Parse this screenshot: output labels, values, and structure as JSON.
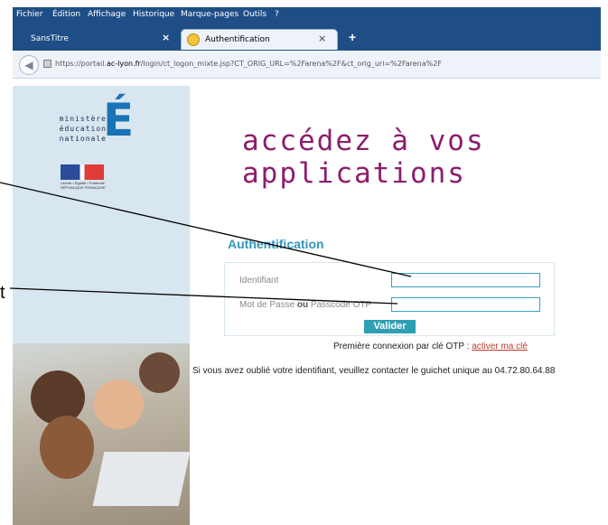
{
  "menu": [
    "Fichier",
    "Édition",
    "Affichage",
    "Historique",
    "Marque-pages",
    "Outils",
    "?"
  ],
  "tabs": {
    "inactive_title": "SansTitre",
    "active_title": "Authentification",
    "close_glyph": "×",
    "new_tab_glyph": "+"
  },
  "address": {
    "prefix": "https://portail.",
    "domain": "ac-lyon.fr",
    "path": "/login/ct_logon_mixte.jsp?CT_ORIG_URL=%2Farena%2F&ct_orig_uri=%2Farena%2F"
  },
  "logo": {
    "lines": [
      "ministère",
      "éducation",
      "nationale"
    ],
    "letter": "É",
    "flag_caption": "Liberté • Égalité • Fraternité RÉPUBLIQUE FRANÇAISE"
  },
  "headline": "accédez à vos applications",
  "auth": {
    "title": "Authentification",
    "id_label": "Identifiant",
    "pw_label_a": "Mot de Passe ",
    "pw_label_b": "ou",
    "pw_label_c": " Passcode OTP",
    "submit": "Valider",
    "otp_text": "Première connexion par clé OTP : ",
    "otp_link": "activer ma clé",
    "forgot": "Si vous avez oublié votre identifiant, veuillez contacter le guichet unique au 04.72.80.64.88"
  },
  "annotation_letter": "t",
  "colors": {
    "chrome": "#1f4e86",
    "headline": "#8c1e6d",
    "accent": "#3296b8",
    "link": "#c0392b"
  }
}
